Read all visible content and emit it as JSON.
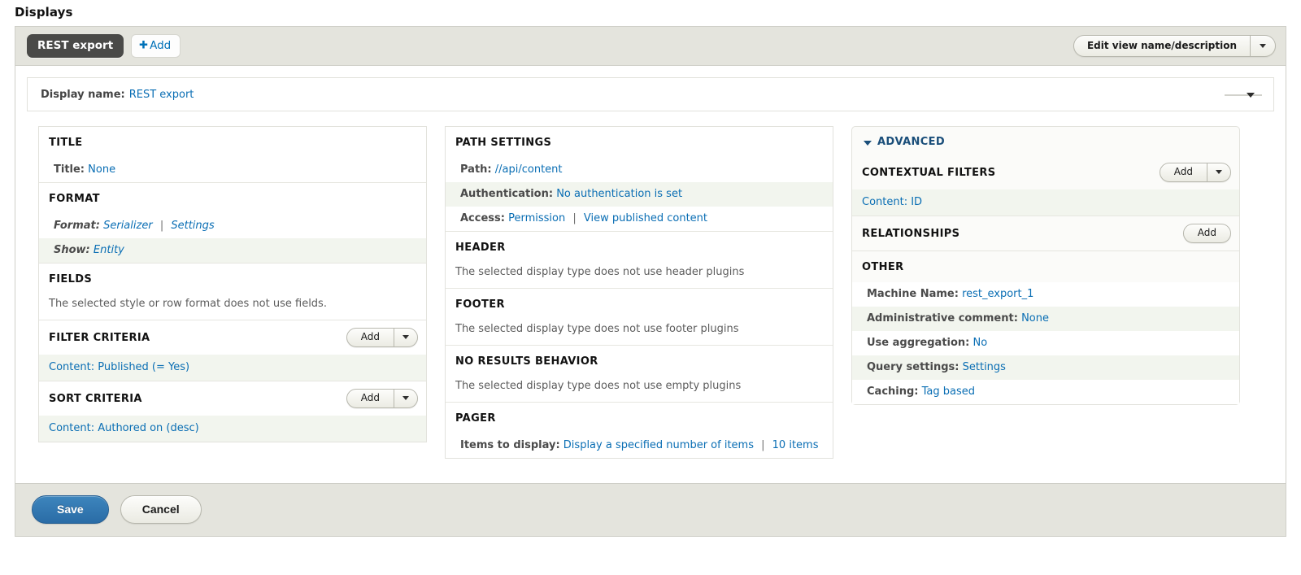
{
  "page": {
    "heading": "Displays"
  },
  "tabs": {
    "active_display": "REST export",
    "add_label": "Add",
    "add_icon": "plus-icon",
    "edit_view_button": "Edit view name/description",
    "dropdown_icon": "chevron-down-icon"
  },
  "display_name": {
    "label": "Display name:",
    "value": "REST export",
    "collapse_icon": "collapse-triangle-icon"
  },
  "columns": {
    "left": [
      {
        "title": "TITLE",
        "rows": [
          {
            "kind": "kv",
            "key": "Title:",
            "value": "None",
            "stripe": false,
            "italic": false
          }
        ]
      },
      {
        "title": "FORMAT",
        "rows": [
          {
            "kind": "kv2",
            "key": "Format:",
            "value": "Serializer",
            "value2": "Settings",
            "separator": "|",
            "stripe": false,
            "italic": true
          },
          {
            "kind": "kv",
            "key": "Show:",
            "value": "Entity",
            "stripe": true,
            "italic": true
          }
        ]
      },
      {
        "title": "FIELDS",
        "note": "The selected style or row format does not use fields."
      },
      {
        "title": "FILTER CRITERIA",
        "add": {
          "label": "Add",
          "has_dropdown": true
        },
        "rows": [
          {
            "kind": "link",
            "value": "Content: Published (= Yes)",
            "stripe": true
          }
        ]
      },
      {
        "title": "SORT CRITERIA",
        "add": {
          "label": "Add",
          "has_dropdown": true
        },
        "rows": [
          {
            "kind": "link",
            "value": "Content: Authored on (desc)",
            "stripe": true
          }
        ]
      }
    ],
    "middle": [
      {
        "title": "PATH SETTINGS",
        "rows": [
          {
            "kind": "kv",
            "key": "Path:",
            "value": "//api/content",
            "stripe": false
          },
          {
            "kind": "kv",
            "key": "Authentication:",
            "value": "No authentication is set",
            "stripe": true
          },
          {
            "kind": "kv2",
            "key": "Access:",
            "value": "Permission",
            "value2": "View published content",
            "separator": "|",
            "stripe": false
          }
        ]
      },
      {
        "title": "HEADER",
        "note": "The selected display type does not use header plugins"
      },
      {
        "title": "FOOTER",
        "note": "The selected display type does not use footer plugins"
      },
      {
        "title": "NO RESULTS BEHAVIOR",
        "note": "The selected display type does not use empty plugins"
      },
      {
        "title": "PAGER",
        "rows": [
          {
            "kind": "kv2",
            "key": "Items to display:",
            "value": "Display a specified number of items",
            "value2": "10 items",
            "separator": "|",
            "stripe": false
          }
        ]
      }
    ],
    "right": {
      "header": {
        "label": "ADVANCED",
        "icon": "triangle-down-icon"
      },
      "buckets": [
        {
          "title": "CONTEXTUAL FILTERS",
          "add": {
            "label": "Add",
            "has_dropdown": true
          },
          "rows": [
            {
              "kind": "link",
              "value": "Content: ID",
              "stripe": true
            }
          ]
        },
        {
          "title": "RELATIONSHIPS",
          "add": {
            "label": "Add",
            "has_dropdown": false
          },
          "rows": []
        },
        {
          "title": "OTHER",
          "rows": [
            {
              "kind": "kv",
              "key": "Machine Name:",
              "value": "rest_export_1",
              "stripe": false
            },
            {
              "kind": "kv",
              "key": "Administrative comment:",
              "value": "None",
              "stripe": true
            },
            {
              "kind": "kv",
              "key": "Use aggregation:",
              "value": "No",
              "stripe": false
            },
            {
              "kind": "kv",
              "key": "Query settings:",
              "value": "Settings",
              "stripe": true
            },
            {
              "kind": "kv",
              "key": "Caching:",
              "value": "Tag based",
              "stripe": false
            }
          ]
        }
      ]
    }
  },
  "actions": {
    "save": "Save",
    "cancel": "Cancel"
  },
  "colors": {
    "link": "#0a6eb4",
    "primary_button": "#2a6ca6",
    "active_tab": "#4a4a48",
    "chrome": "#e4e4dd",
    "stripe": "#f2f5ee",
    "advanced_title": "#1a4e7a"
  }
}
